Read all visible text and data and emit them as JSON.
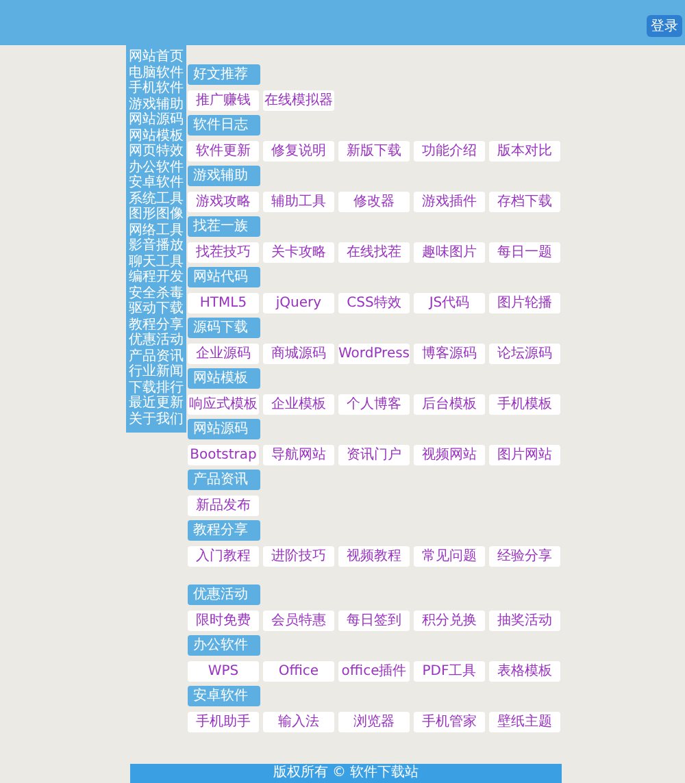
{
  "header": {
    "login_button": "登录"
  },
  "sidebar": {
    "items": [
      "网站首页",
      "电脑软件",
      "手机软件",
      "游戏辅助",
      "网站源码",
      "网站模板",
      "网页特效",
      "办公软件",
      "安卓软件",
      "系统工具",
      "图形图像",
      "网络工具",
      "影音播放",
      "聊天工具",
      "编程开发",
      "安全杀毒",
      "驱动下载",
      "教程分享",
      "优惠活动",
      "产品资讯",
      "行业新闻",
      "下载排行",
      "最近更新",
      "关于我们"
    ]
  },
  "sections": [
    {
      "title": "好文推荐",
      "links": [
        "推广赚钱",
        "在线模拟器"
      ]
    },
    {
      "title": "软件日志",
      "links": [
        "软件更新",
        "修复说明",
        "新版下载",
        "功能介绍",
        "版本对比"
      ]
    },
    {
      "title": "游戏辅助",
      "links": [
        "游戏攻略",
        "辅助工具",
        "修改器",
        "游戏插件",
        "存档下载"
      ]
    },
    {
      "title": "找茬一族",
      "links": [
        "找茬技巧",
        "关卡攻略",
        "在线找茬",
        "趣味图片",
        "每日一题"
      ]
    },
    {
      "title": "网站代码",
      "links": [
        "HTML5",
        "jQuery",
        "CSS特效",
        "JS代码",
        "图片轮播"
      ]
    },
    {
      "title": "源码下载",
      "links": [
        "企业源码",
        "商城源码",
        "WordPress",
        "博客源码",
        "论坛源码"
      ]
    },
    {
      "title": "网站模板",
      "links": [
        "响应式模板",
        "企业模板",
        "个人博客",
        "后台模板",
        "手机模板"
      ]
    },
    {
      "title": "网站源码",
      "links": [
        "Bootstrap",
        "导航网站",
        "资讯门户",
        "视频网站",
        "图片网站"
      ]
    },
    {
      "title": "产品资讯",
      "links": [
        "新品发布"
      ]
    },
    {
      "title": "教程分享",
      "links": [
        "入门教程",
        "进阶技巧",
        "视频教程",
        "常见问题",
        "经验分享"
      ]
    },
    {
      "title": "优惠活动",
      "links": [
        "限时免费",
        "会员特惠",
        "每日签到",
        "积分兑换",
        "抽奖活动"
      ]
    },
    {
      "title": "办公软件",
      "links": [
        "WPS",
        "Office",
        "office插件",
        "PDF工具",
        "表格模板"
      ]
    },
    {
      "title": "安卓软件",
      "links": [
        "手机助手",
        "输入法",
        "浏览器",
        "手机管家",
        "壁纸主题"
      ]
    }
  ],
  "footer": {
    "text": "版权所有 © 软件下载站"
  }
}
